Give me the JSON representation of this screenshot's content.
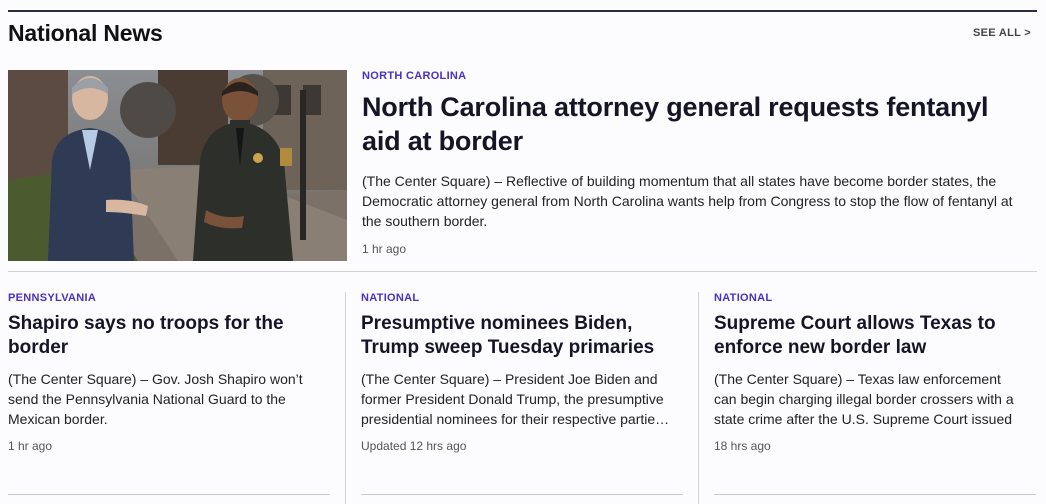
{
  "section": {
    "title": "National News",
    "see_all": "SEE ALL >"
  },
  "lead": {
    "kicker": "NORTH CAROLINA",
    "headline": "North Carolina attorney general requests fentanyl aid at border",
    "summary": "(The Center Square) – Reflective of building momentum that all states have become border states, the Democratic attorney general from North Carolina wants help from Congress to stop the flow of fentanyl at the southern border.",
    "time": "1 hr ago"
  },
  "cards": [
    {
      "kicker": "PENNSYLVANIA",
      "headline": "Shapiro says no troops for the border",
      "summary": "(The Center Square) – Gov. Josh Shapiro won’t send the Pennsylvania National Guard to the Mexican border.",
      "time": "1 hr ago"
    },
    {
      "kicker": "NATIONAL",
      "headline": "Presumptive nominees Biden, Trump sweep Tuesday primaries",
      "summary": "(The Center Square) – President Joe Biden and former President Donald Trump, the presumptive presidential nominees for their respective partie…",
      "time": "Updated 12 hrs ago"
    },
    {
      "kicker": "NATIONAL",
      "headline": "Supreme Court allows Texas to enforce new border law",
      "summary": "(The Center Square) – Texas law enforcement can begin charging illegal border crossers with a state crime after the U.S. Supreme Court issued …",
      "time": "18 hrs ago"
    }
  ],
  "colors": {
    "kicker": "#4b2fc7",
    "headline": "#151526",
    "rule": "#2b2d42"
  }
}
